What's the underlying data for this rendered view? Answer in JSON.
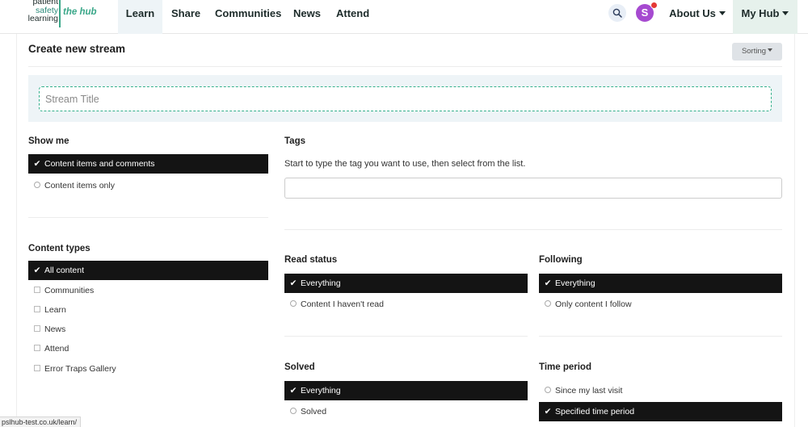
{
  "brand": {
    "line1": "patient",
    "line2": "safety",
    "line3": "learning",
    "tagline": "the hub"
  },
  "nav": {
    "items": [
      {
        "label": "Learn"
      },
      {
        "label": "Share"
      },
      {
        "label": "Communities"
      },
      {
        "label": "News"
      },
      {
        "label": "Attend"
      }
    ],
    "avatar_initial": "S",
    "about_label": "About Us",
    "myhub_label": "My Hub"
  },
  "page": {
    "title": "Create new stream",
    "sorting_label": "Sorting",
    "stream_title_placeholder": "Stream Title"
  },
  "show_me": {
    "heading": "Show me",
    "options": [
      {
        "label": "Content items and comments",
        "selected": true
      },
      {
        "label": "Content items only",
        "selected": false
      }
    ]
  },
  "tags": {
    "heading": "Tags",
    "help": "Start to type the tag you want to use, then select from the list.",
    "value": ""
  },
  "content_types": {
    "heading": "Content types",
    "options": [
      {
        "label": "All content",
        "selected": true
      },
      {
        "label": "Communities",
        "selected": false
      },
      {
        "label": "Learn",
        "selected": false
      },
      {
        "label": "News",
        "selected": false
      },
      {
        "label": "Attend",
        "selected": false
      },
      {
        "label": "Error Traps Gallery",
        "selected": false
      }
    ]
  },
  "read_status": {
    "heading": "Read status",
    "options": [
      {
        "label": "Everything",
        "selected": true
      },
      {
        "label": "Content I haven't read",
        "selected": false
      }
    ]
  },
  "following": {
    "heading": "Following",
    "options": [
      {
        "label": "Everything",
        "selected": true
      },
      {
        "label": "Only content I follow",
        "selected": false
      }
    ]
  },
  "solved": {
    "heading": "Solved",
    "options": [
      {
        "label": "Everything",
        "selected": true
      },
      {
        "label": "Solved",
        "selected": false
      }
    ]
  },
  "time_period": {
    "heading": "Time period",
    "options": [
      {
        "label": "Since my last visit",
        "selected": false
      },
      {
        "label": "Specified time period",
        "selected": true
      }
    ]
  },
  "status_bar": {
    "url": "pslhub-test.co.uk/learn/"
  },
  "colors": {
    "accent_green": "#3aa789",
    "selected_bg": "#141414",
    "avatar": "#a64ad0",
    "notification": "#e53935"
  }
}
